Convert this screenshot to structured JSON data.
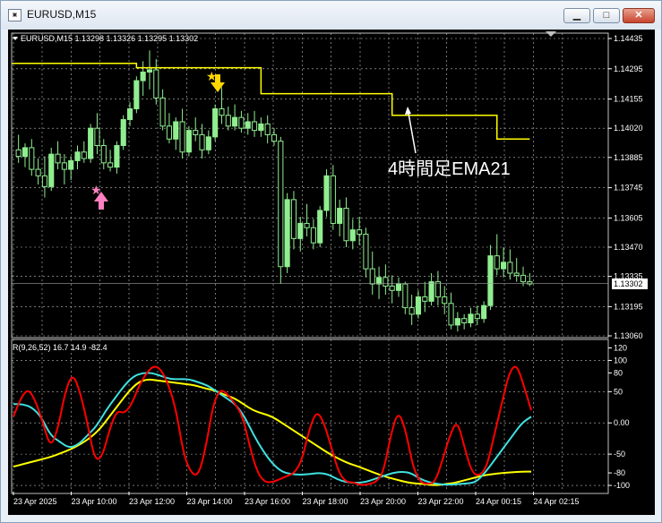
{
  "window": {
    "title": "EURUSD,M15",
    "min_glyph": "▁",
    "max_glyph": "□",
    "close_glyph": "✕"
  },
  "colors": {
    "background": "#000000",
    "grid": "#c0c0c0",
    "candle": "#90ee90",
    "ema": "#ffff00",
    "rsi_red": "#ff0000",
    "rsi_cyan": "#40e0e0",
    "rsi_yellow": "#ffff00",
    "buy_arrow": "#ff80c0",
    "sell_arrow": "#ffd700"
  },
  "main_panel": {
    "header": "EURUSD,M15  1.13298 1.13326 1.13295 1.13302",
    "header_icon": "dropdown-triangle-icon",
    "price_ticks": [
      "1.14435",
      "1.14295",
      "1.14155",
      "1.14020",
      "1.13885",
      "1.13745",
      "1.13605",
      "1.13470",
      "1.13335",
      "1.13195",
      "1.13060"
    ],
    "current_price": "1.13302",
    "annotation": "4時間足EMA21",
    "buy_signal_icon": "pink-star-up-arrow-icon",
    "sell_signal_icon": "yellow-star-down-arrow-icon"
  },
  "sub_panel": {
    "header": "R(9,26,52) 16.7 14.9 -82.4",
    "ticks": [
      "120",
      "100",
      "80",
      "50",
      "0.00",
      "-50",
      "-80",
      "-100"
    ]
  },
  "time_axis": [
    "23 Apr 2025",
    "23 Apr 10:00",
    "23 Apr 12:00",
    "23 Apr 14:00",
    "23 Apr 16:00",
    "23 Apr 18:00",
    "23 Apr 20:00",
    "23 Apr 22:00",
    "24 Apr 00:15",
    "24 Apr 02:15"
  ],
  "chart_data": {
    "type": "candlestick",
    "symbol": "EURUSD",
    "timeframe": "M15",
    "ylim": [
      1.1306,
      1.14435
    ],
    "candles": [
      {
        "o": 1.1392,
        "h": 1.1399,
        "l": 1.1386,
        "c": 1.1389
      },
      {
        "o": 1.1389,
        "h": 1.1395,
        "l": 1.1384,
        "c": 1.1393
      },
      {
        "o": 1.1393,
        "h": 1.1397,
        "l": 1.138,
        "c": 1.1383
      },
      {
        "o": 1.1383,
        "h": 1.1388,
        "l": 1.1376,
        "c": 1.138
      },
      {
        "o": 1.138,
        "h": 1.1389,
        "l": 1.137,
        "c": 1.1375
      },
      {
        "o": 1.1375,
        "h": 1.1393,
        "l": 1.1373,
        "c": 1.139
      },
      {
        "o": 1.139,
        "h": 1.1396,
        "l": 1.1383,
        "c": 1.1386
      },
      {
        "o": 1.1386,
        "h": 1.139,
        "l": 1.1376,
        "c": 1.1383
      },
      {
        "o": 1.1383,
        "h": 1.1389,
        "l": 1.1378,
        "c": 1.1387
      },
      {
        "o": 1.1387,
        "h": 1.1394,
        "l": 1.1383,
        "c": 1.1391
      },
      {
        "o": 1.1391,
        "h": 1.1396,
        "l": 1.1386,
        "c": 1.1388
      },
      {
        "o": 1.1388,
        "h": 1.1404,
        "l": 1.1386,
        "c": 1.1402
      },
      {
        "o": 1.1402,
        "h": 1.1409,
        "l": 1.139,
        "c": 1.1394
      },
      {
        "o": 1.1394,
        "h": 1.1397,
        "l": 1.1383,
        "c": 1.1386
      },
      {
        "o": 1.1386,
        "h": 1.1392,
        "l": 1.1382,
        "c": 1.1384
      },
      {
        "o": 1.1384,
        "h": 1.1396,
        "l": 1.1381,
        "c": 1.1394
      },
      {
        "o": 1.1394,
        "h": 1.1408,
        "l": 1.1392,
        "c": 1.1406
      },
      {
        "o": 1.1406,
        "h": 1.1414,
        "l": 1.1403,
        "c": 1.1411
      },
      {
        "o": 1.1411,
        "h": 1.1426,
        "l": 1.1409,
        "c": 1.1424
      },
      {
        "o": 1.1424,
        "h": 1.1433,
        "l": 1.1417,
        "c": 1.1428
      },
      {
        "o": 1.1428,
        "h": 1.1438,
        "l": 1.142,
        "c": 1.1429
      },
      {
        "o": 1.1429,
        "h": 1.1434,
        "l": 1.1413,
        "c": 1.1416
      },
      {
        "o": 1.1416,
        "h": 1.142,
        "l": 1.1401,
        "c": 1.1403
      },
      {
        "o": 1.1403,
        "h": 1.1409,
        "l": 1.1395,
        "c": 1.1397
      },
      {
        "o": 1.1397,
        "h": 1.1407,
        "l": 1.1392,
        "c": 1.1405
      },
      {
        "o": 1.1405,
        "h": 1.1411,
        "l": 1.1388,
        "c": 1.1391
      },
      {
        "o": 1.1391,
        "h": 1.1403,
        "l": 1.1389,
        "c": 1.1401
      },
      {
        "o": 1.1401,
        "h": 1.1407,
        "l": 1.1396,
        "c": 1.1399
      },
      {
        "o": 1.1399,
        "h": 1.1404,
        "l": 1.1388,
        "c": 1.1392
      },
      {
        "o": 1.1392,
        "h": 1.1401,
        "l": 1.139,
        "c": 1.1398
      },
      {
        "o": 1.1398,
        "h": 1.1413,
        "l": 1.1396,
        "c": 1.1411
      },
      {
        "o": 1.1411,
        "h": 1.1421,
        "l": 1.1404,
        "c": 1.1408
      },
      {
        "o": 1.1408,
        "h": 1.1412,
        "l": 1.1401,
        "c": 1.1403
      },
      {
        "o": 1.1403,
        "h": 1.1413,
        "l": 1.1401,
        "c": 1.1407
      },
      {
        "o": 1.1407,
        "h": 1.141,
        "l": 1.14,
        "c": 1.1402
      },
      {
        "o": 1.1402,
        "h": 1.1409,
        "l": 1.1399,
        "c": 1.1405
      },
      {
        "o": 1.1405,
        "h": 1.141,
        "l": 1.1398,
        "c": 1.1401
      },
      {
        "o": 1.1401,
        "h": 1.1407,
        "l": 1.1398,
        "c": 1.1404
      },
      {
        "o": 1.1404,
        "h": 1.1408,
        "l": 1.1395,
        "c": 1.1399
      },
      {
        "o": 1.1399,
        "h": 1.1402,
        "l": 1.1394,
        "c": 1.1396
      },
      {
        "o": 1.1396,
        "h": 1.1398,
        "l": 1.133,
        "c": 1.1338
      },
      {
        "o": 1.1338,
        "h": 1.1372,
        "l": 1.1335,
        "c": 1.1369
      },
      {
        "o": 1.1369,
        "h": 1.1373,
        "l": 1.1346,
        "c": 1.1351
      },
      {
        "o": 1.1351,
        "h": 1.1361,
        "l": 1.1345,
        "c": 1.1358
      },
      {
        "o": 1.1358,
        "h": 1.1367,
        "l": 1.1352,
        "c": 1.1356
      },
      {
        "o": 1.1356,
        "h": 1.136,
        "l": 1.1346,
        "c": 1.1349
      },
      {
        "o": 1.1349,
        "h": 1.1366,
        "l": 1.1347,
        "c": 1.1364
      },
      {
        "o": 1.1364,
        "h": 1.1383,
        "l": 1.1361,
        "c": 1.138
      },
      {
        "o": 1.138,
        "h": 1.1385,
        "l": 1.1355,
        "c": 1.1358
      },
      {
        "o": 1.1358,
        "h": 1.1369,
        "l": 1.1352,
        "c": 1.1365
      },
      {
        "o": 1.1365,
        "h": 1.137,
        "l": 1.1347,
        "c": 1.135
      },
      {
        "o": 1.135,
        "h": 1.136,
        "l": 1.1346,
        "c": 1.1355
      },
      {
        "o": 1.1355,
        "h": 1.1361,
        "l": 1.1348,
        "c": 1.1353
      },
      {
        "o": 1.1353,
        "h": 1.1356,
        "l": 1.1333,
        "c": 1.1337
      },
      {
        "o": 1.1337,
        "h": 1.1345,
        "l": 1.1325,
        "c": 1.133
      },
      {
        "o": 1.133,
        "h": 1.1338,
        "l": 1.1323,
        "c": 1.1333
      },
      {
        "o": 1.1333,
        "h": 1.1339,
        "l": 1.1325,
        "c": 1.1329
      },
      {
        "o": 1.1329,
        "h": 1.1334,
        "l": 1.1321,
        "c": 1.1327
      },
      {
        "o": 1.1327,
        "h": 1.1333,
        "l": 1.1324,
        "c": 1.133
      },
      {
        "o": 1.133,
        "h": 1.1331,
        "l": 1.1316,
        "c": 1.1319
      },
      {
        "o": 1.1319,
        "h": 1.1325,
        "l": 1.1311,
        "c": 1.1316
      },
      {
        "o": 1.1316,
        "h": 1.1327,
        "l": 1.1314,
        "c": 1.1324
      },
      {
        "o": 1.1324,
        "h": 1.1331,
        "l": 1.1317,
        "c": 1.1322
      },
      {
        "o": 1.1322,
        "h": 1.1335,
        "l": 1.132,
        "c": 1.1331
      },
      {
        "o": 1.1331,
        "h": 1.1336,
        "l": 1.132,
        "c": 1.1324
      },
      {
        "o": 1.1324,
        "h": 1.1329,
        "l": 1.1316,
        "c": 1.1321
      },
      {
        "o": 1.1321,
        "h": 1.1326,
        "l": 1.1309,
        "c": 1.1311
      },
      {
        "o": 1.1311,
        "h": 1.1317,
        "l": 1.1308,
        "c": 1.1314
      },
      {
        "o": 1.1314,
        "h": 1.1316,
        "l": 1.1309,
        "c": 1.1312
      },
      {
        "o": 1.1312,
        "h": 1.1319,
        "l": 1.131,
        "c": 1.1316
      },
      {
        "o": 1.1316,
        "h": 1.132,
        "l": 1.1311,
        "c": 1.1314
      },
      {
        "o": 1.1314,
        "h": 1.1322,
        "l": 1.1312,
        "c": 1.132
      },
      {
        "o": 1.132,
        "h": 1.1348,
        "l": 1.1318,
        "c": 1.1343
      },
      {
        "o": 1.1343,
        "h": 1.1353,
        "l": 1.1334,
        "c": 1.1337
      },
      {
        "o": 1.1337,
        "h": 1.1347,
        "l": 1.1333,
        "c": 1.134
      },
      {
        "o": 1.134,
        "h": 1.1346,
        "l": 1.1332,
        "c": 1.1335
      },
      {
        "o": 1.1335,
        "h": 1.1342,
        "l": 1.1331,
        "c": 1.1334
      },
      {
        "o": 1.1334,
        "h": 1.1338,
        "l": 1.1329,
        "c": 1.1331
      },
      {
        "o": 1.1331,
        "h": 1.1335,
        "l": 1.1329,
        "c": 1.133
      }
    ],
    "ema_h4": [
      {
        "from": 0,
        "to": 18,
        "value": 1.1432
      },
      {
        "from": 18,
        "to": 37,
        "value": 1.143
      },
      {
        "from": 37,
        "to": 57,
        "value": 1.1418
      },
      {
        "from": 57,
        "to": 73,
        "value": 1.1408
      },
      {
        "from": 73,
        "to": 82,
        "value": 1.1397
      }
    ],
    "sub_ylim": [
      -110,
      125
    ],
    "rsi_red": [
      10,
      40,
      55,
      35,
      0,
      -40,
      -10,
      50,
      80,
      50,
      0,
      -60,
      -55,
      -10,
      20,
      15,
      30,
      60,
      80,
      92,
      85,
      60,
      20,
      -50,
      -80,
      -85,
      -40,
      30,
      55,
      45,
      30,
      10,
      -40,
      -80,
      -95,
      -95,
      -90,
      -85,
      -80,
      -60,
      -10,
      20,
      0,
      -40,
      -80,
      -95,
      -95,
      -100,
      -98,
      -95,
      -80,
      -20,
      20,
      -10,
      -70,
      -95,
      -98,
      -95,
      -60,
      -20,
      5,
      -40,
      -80,
      -85,
      -70,
      -20,
      30,
      80,
      95,
      60,
      20
    ],
    "rsi_cyan": [
      30,
      30,
      25,
      10,
      -20,
      -30,
      -40,
      -35,
      -20,
      -5,
      20,
      40,
      60,
      75,
      80,
      80,
      75,
      70,
      70,
      70,
      65,
      60,
      50,
      40,
      30,
      10,
      -20,
      -45,
      -65,
      -78,
      -82,
      -83,
      -82,
      -80,
      -82,
      -90,
      -95,
      -96,
      -95,
      -90,
      -85,
      -80,
      -78,
      -80,
      -90,
      -95,
      -98,
      -99,
      -98,
      -97,
      -95,
      -80,
      -60,
      -40,
      -20,
      0,
      10
    ],
    "rsi_yellow": [
      -70,
      -66,
      -62,
      -58,
      -54,
      -48,
      -42,
      -34,
      -24,
      -10,
      10,
      30,
      50,
      65,
      70,
      68,
      66,
      64,
      62,
      60,
      55,
      52,
      45,
      40,
      30,
      20,
      15,
      10,
      0,
      -10,
      -20,
      -30,
      -40,
      -50,
      -58,
      -65,
      -70,
      -76,
      -82,
      -87,
      -91,
      -95,
      -97,
      -98,
      -100,
      -98,
      -96,
      -92,
      -88,
      -84,
      -82,
      -80,
      -79,
      -78,
      -78
    ]
  }
}
